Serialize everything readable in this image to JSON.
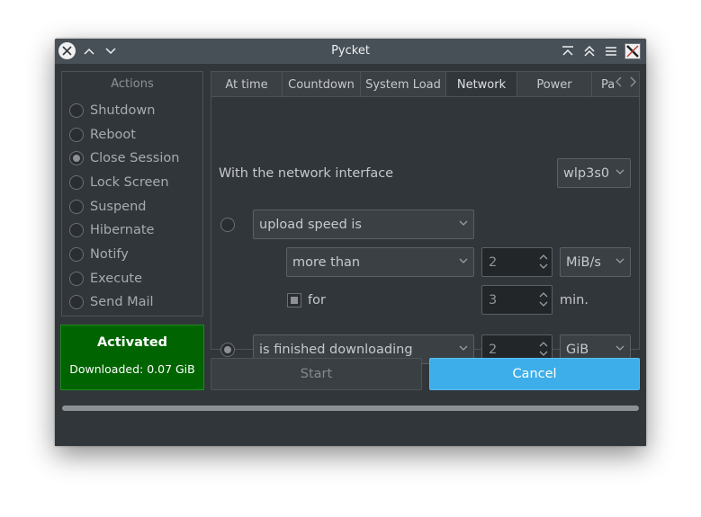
{
  "window": {
    "title": "Pycket"
  },
  "actions": {
    "title": "Actions",
    "items": [
      {
        "label": "Shutdown",
        "checked": false
      },
      {
        "label": "Reboot",
        "checked": false
      },
      {
        "label": "Close Session",
        "checked": true
      },
      {
        "label": "Lock Screen",
        "checked": false
      },
      {
        "label": "Suspend",
        "checked": false
      },
      {
        "label": "Hibernate",
        "checked": false
      },
      {
        "label": "Notify",
        "checked": false
      },
      {
        "label": "Execute",
        "checked": false
      },
      {
        "label": "Send Mail",
        "checked": false
      }
    ]
  },
  "status": {
    "title": "Activated",
    "detail": "Downloaded: 0.07 GiB",
    "color": "#006400"
  },
  "tabs": [
    {
      "label": "At time"
    },
    {
      "label": "Countdown"
    },
    {
      "label": "System Load"
    },
    {
      "label": "Network",
      "active": true
    },
    {
      "label": "Power"
    },
    {
      "label": "Pa"
    }
  ],
  "network": {
    "interface_label": "With the network interface",
    "interface_value": "wlp3s0",
    "upload_condition": "upload speed is",
    "comparison": "more than",
    "speed_value": "2",
    "speed_unit": "MiB/s",
    "for_label": "for",
    "duration_value": "3",
    "duration_unit": "min.",
    "download_condition": "is finished downloading",
    "download_value": "2",
    "download_unit": "GiB"
  },
  "buttons": {
    "start": "Start",
    "cancel": "Cancel"
  },
  "progress": {
    "fraction": 1.0
  },
  "colors": {
    "accent": "#3daee9",
    "background": "#31363b",
    "titlebar": "#475057"
  }
}
